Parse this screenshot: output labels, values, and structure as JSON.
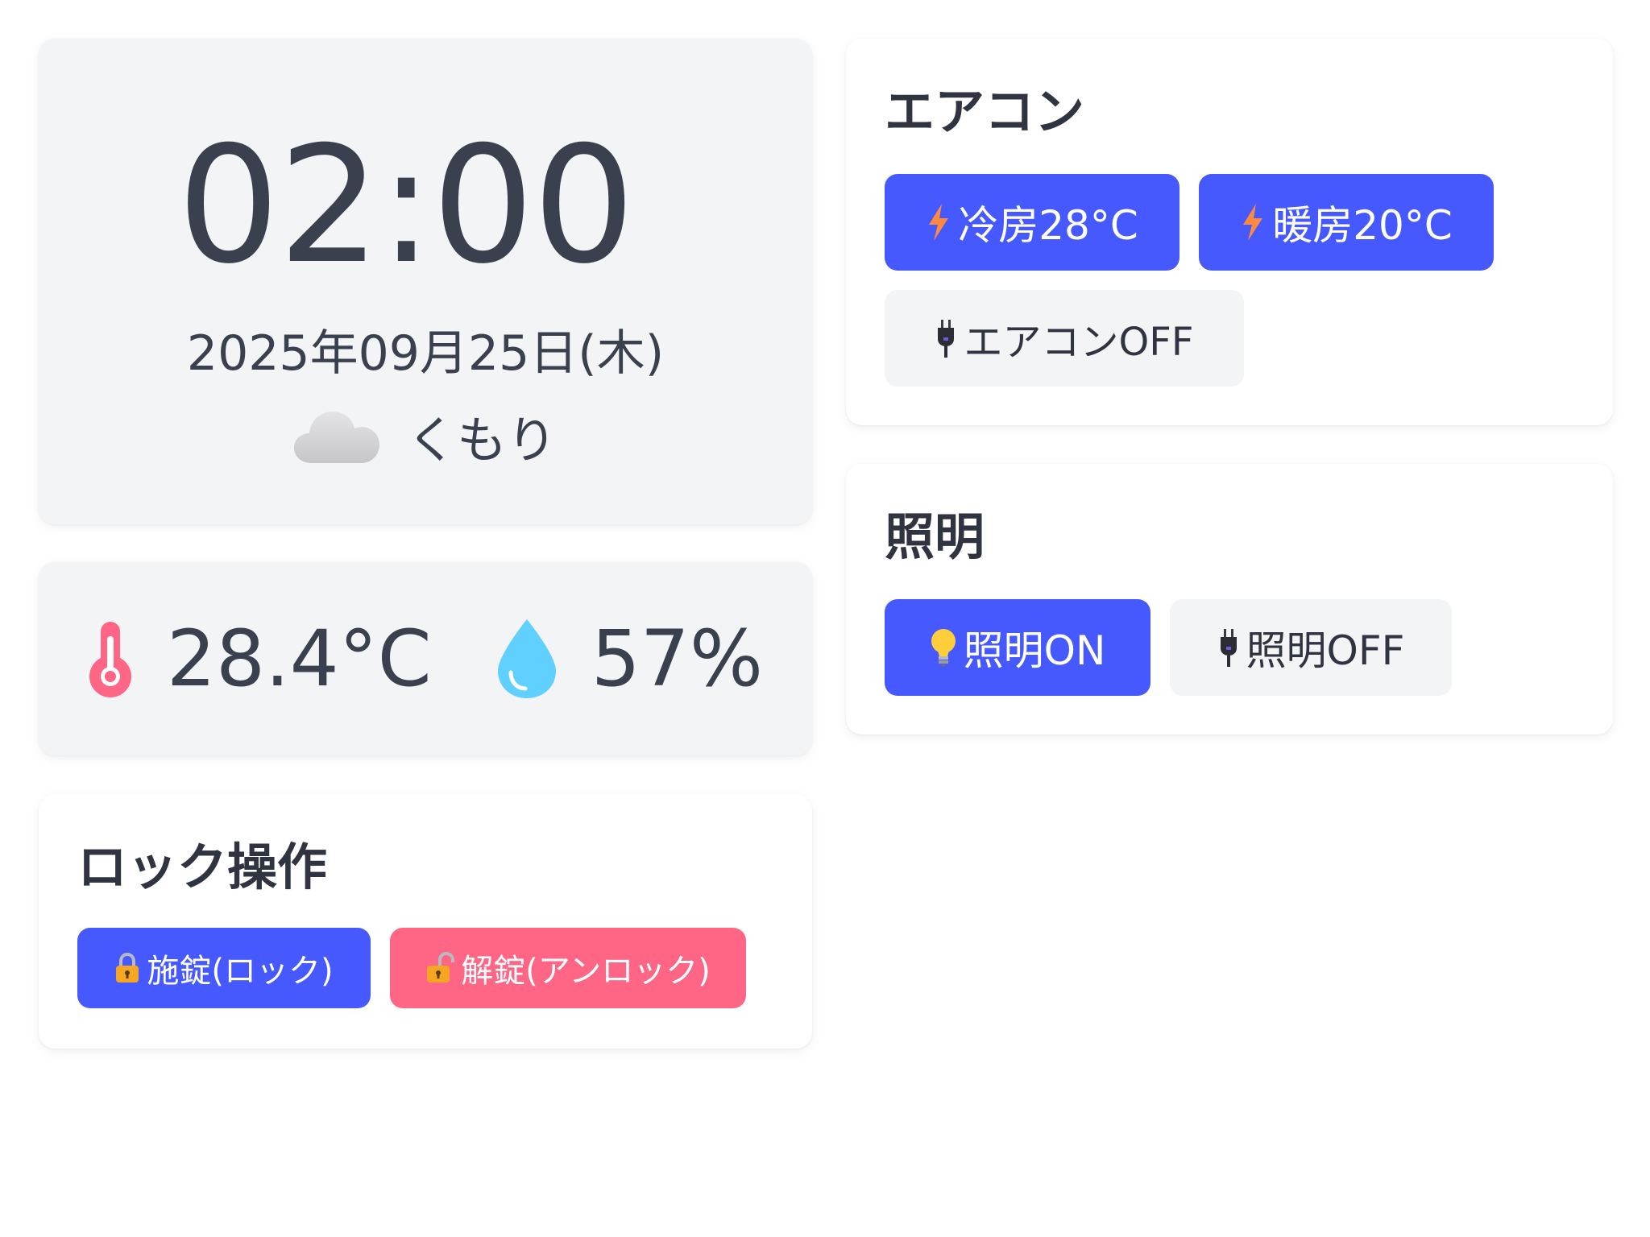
{
  "clock": {
    "time": "02:00",
    "date": "2025年09月25日(木)",
    "weather_icon": "cloud-icon",
    "weather_text": "くもり"
  },
  "sensors": {
    "temperature": "28.4°C",
    "temperature_icon": "thermometer-icon",
    "humidity": "57%",
    "humidity_icon": "water-drop-icon"
  },
  "lock": {
    "title": "ロック操作",
    "lock_label": "施錠(ロック)",
    "unlock_label": "解錠(アンロック)"
  },
  "aircon": {
    "title": "エアコン",
    "cool_label": "冷房28°C",
    "heat_label": "暖房20°C",
    "off_label": "エアコンOFF"
  },
  "light": {
    "title": "照明",
    "on_label": "照明ON",
    "off_label": "照明OFF"
  },
  "colors": {
    "primary": "#4659ff",
    "danger": "#ff6685",
    "card_gray": "#f3f4f6",
    "text": "#3a404d",
    "bolt": "#ff8a3d",
    "thermometer": "#ff6685",
    "water": "#5fd0ff"
  }
}
